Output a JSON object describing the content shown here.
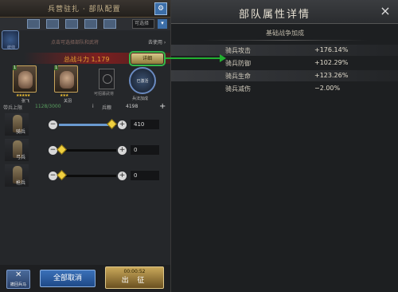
{
  "header": {
    "title": "兵营驻扎 · 部队配置",
    "gear_icon": "gear-icon"
  },
  "tabs": {
    "select_value": "可选择",
    "drop": "▾"
  },
  "commander": {
    "label": "统帅"
  },
  "hints": {
    "left": "点击可选择部队和武将",
    "right": "去使用 ›"
  },
  "power": {
    "label": "总战斗力",
    "value": "1,179"
  },
  "detail_button": "详细",
  "heroes": [
    {
      "level": "1",
      "stars": "★★★★★",
      "name": "张飞"
    },
    {
      "level": "1",
      "stars": "★★★",
      "name": "关羽"
    }
  ],
  "slot_empty_label": "可招募武将",
  "orb": {
    "text": "已激活",
    "label": "兵法加成"
  },
  "troops_header": {
    "label": "带兵上限",
    "count": "1128/3000",
    "info": "i",
    "food_label": "兵粮",
    "food": "4198",
    "plus": "+"
  },
  "troops": [
    {
      "name": "骑兵",
      "value": "410",
      "fraction": 0.93
    },
    {
      "name": "弓兵",
      "value": "0",
      "fraction": 0.05
    },
    {
      "name": "枪兵",
      "value": "0",
      "fraction": 0.05
    }
  ],
  "bottom": {
    "cancel_icon_label": "撤回兵马",
    "cancel_all": "全部取消",
    "march_time": "00:00:52",
    "march": "出 征"
  },
  "right_panel": {
    "title": "部队属性详情",
    "close": "×",
    "section": "基础战争加成",
    "stats": [
      {
        "name": "骑兵攻击",
        "value": "+176.14%"
      },
      {
        "name": "骑兵防御",
        "value": "+102.29%"
      },
      {
        "name": "骑兵生命",
        "value": "+123.26%"
      },
      {
        "name": "骑兵减伤",
        "value": "−2.00%"
      }
    ]
  },
  "colors": {
    "highlight": "#34b84a",
    "accent": "#e6a030"
  }
}
